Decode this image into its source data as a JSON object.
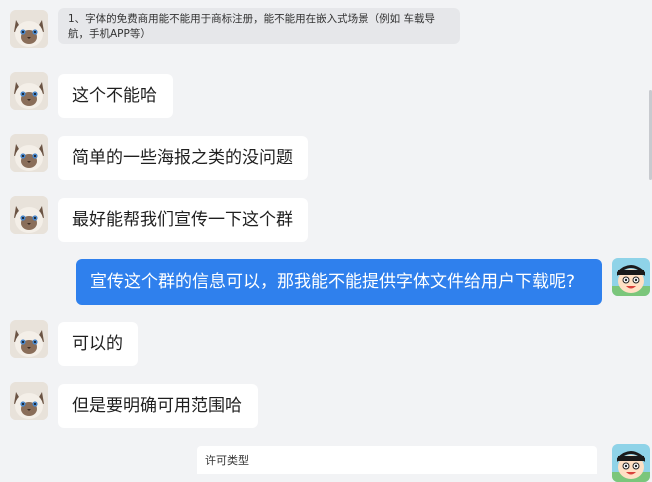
{
  "messages": [
    {
      "sender": "other",
      "avatar": "cat-avatar",
      "text": "1、字体的免费商用能不能用于商标注册，能不能用在嵌入式场景（例如 车载导航，手机APP等）"
    },
    {
      "sender": "other",
      "avatar": "cat-avatar",
      "text": "这个不能哈"
    },
    {
      "sender": "other",
      "avatar": "cat-avatar",
      "text": "简单的一些海报之类的没问题"
    },
    {
      "sender": "other",
      "avatar": "cat-avatar",
      "text": "最好能帮我们宣传一下这个群"
    },
    {
      "sender": "self",
      "avatar": "cartoon-avatar",
      "text": "宣传这个群的信息可以，那我能不能提供字体文件给用户下载呢?"
    },
    {
      "sender": "other",
      "avatar": "cat-avatar",
      "text": "可以的"
    },
    {
      "sender": "other",
      "avatar": "cat-avatar",
      "text": "但是要明确可用范围哈"
    },
    {
      "sender": "self",
      "avatar": "cartoon-avatar",
      "text": "许可类型"
    }
  ],
  "colors": {
    "background": "#f2f3f5",
    "bubble_other": "#ffffff",
    "bubble_self": "#2f80ed",
    "quote_bubble": "#e6e7ea"
  }
}
